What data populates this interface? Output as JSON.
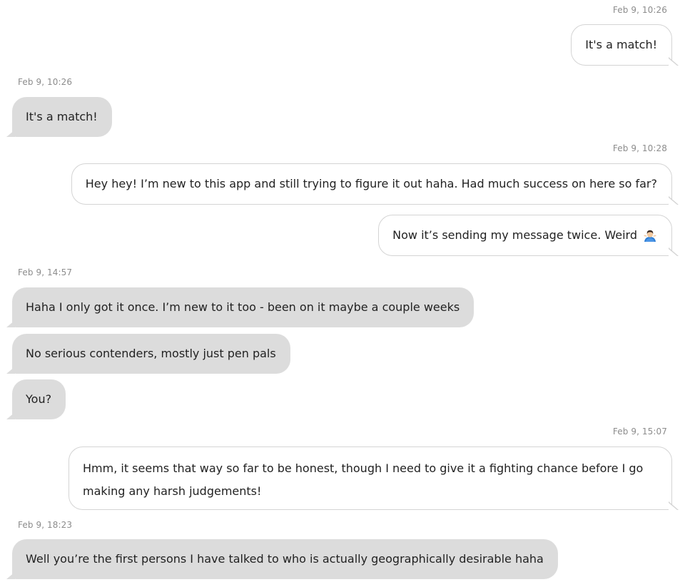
{
  "messages": [
    {
      "timestamp": "Feb 9, 10:26",
      "text": "It's a match!"
    },
    {
      "timestamp": "Feb 9, 10:26",
      "text": "It's a match!"
    },
    {
      "timestamp": "Feb 9, 10:28",
      "text": "Hey hey! I’m new to this app and still trying to figure it out haha. Had much success on here so far?"
    },
    {
      "text": "Now it’s sending my message twice. Weird",
      "icon": "person-shrugging-emoji"
    },
    {
      "timestamp": "Feb 9, 14:57",
      "text": "Haha I only got it once. I’m new to it too - been on it maybe a couple weeks"
    },
    {
      "text": "No serious contenders, mostly just pen pals"
    },
    {
      "text": "You?"
    },
    {
      "timestamp": "Feb 9, 15:07",
      "text": "Hmm, it seems that way so far to be honest, though I need to give it a fighting chance before I go making any harsh judgements!"
    },
    {
      "timestamp": "Feb 9, 18:23",
      "text": "Well you’re the first persons I have talked to who is actually geographically desirable haha"
    }
  ],
  "colors": {
    "incoming_bubble": "#dcdcdc",
    "outgoing_bubble": "#ffffff",
    "outgoing_border": "#d4d4d4",
    "timestamp_text": "#8c8c8c",
    "message_text": "#222222"
  }
}
